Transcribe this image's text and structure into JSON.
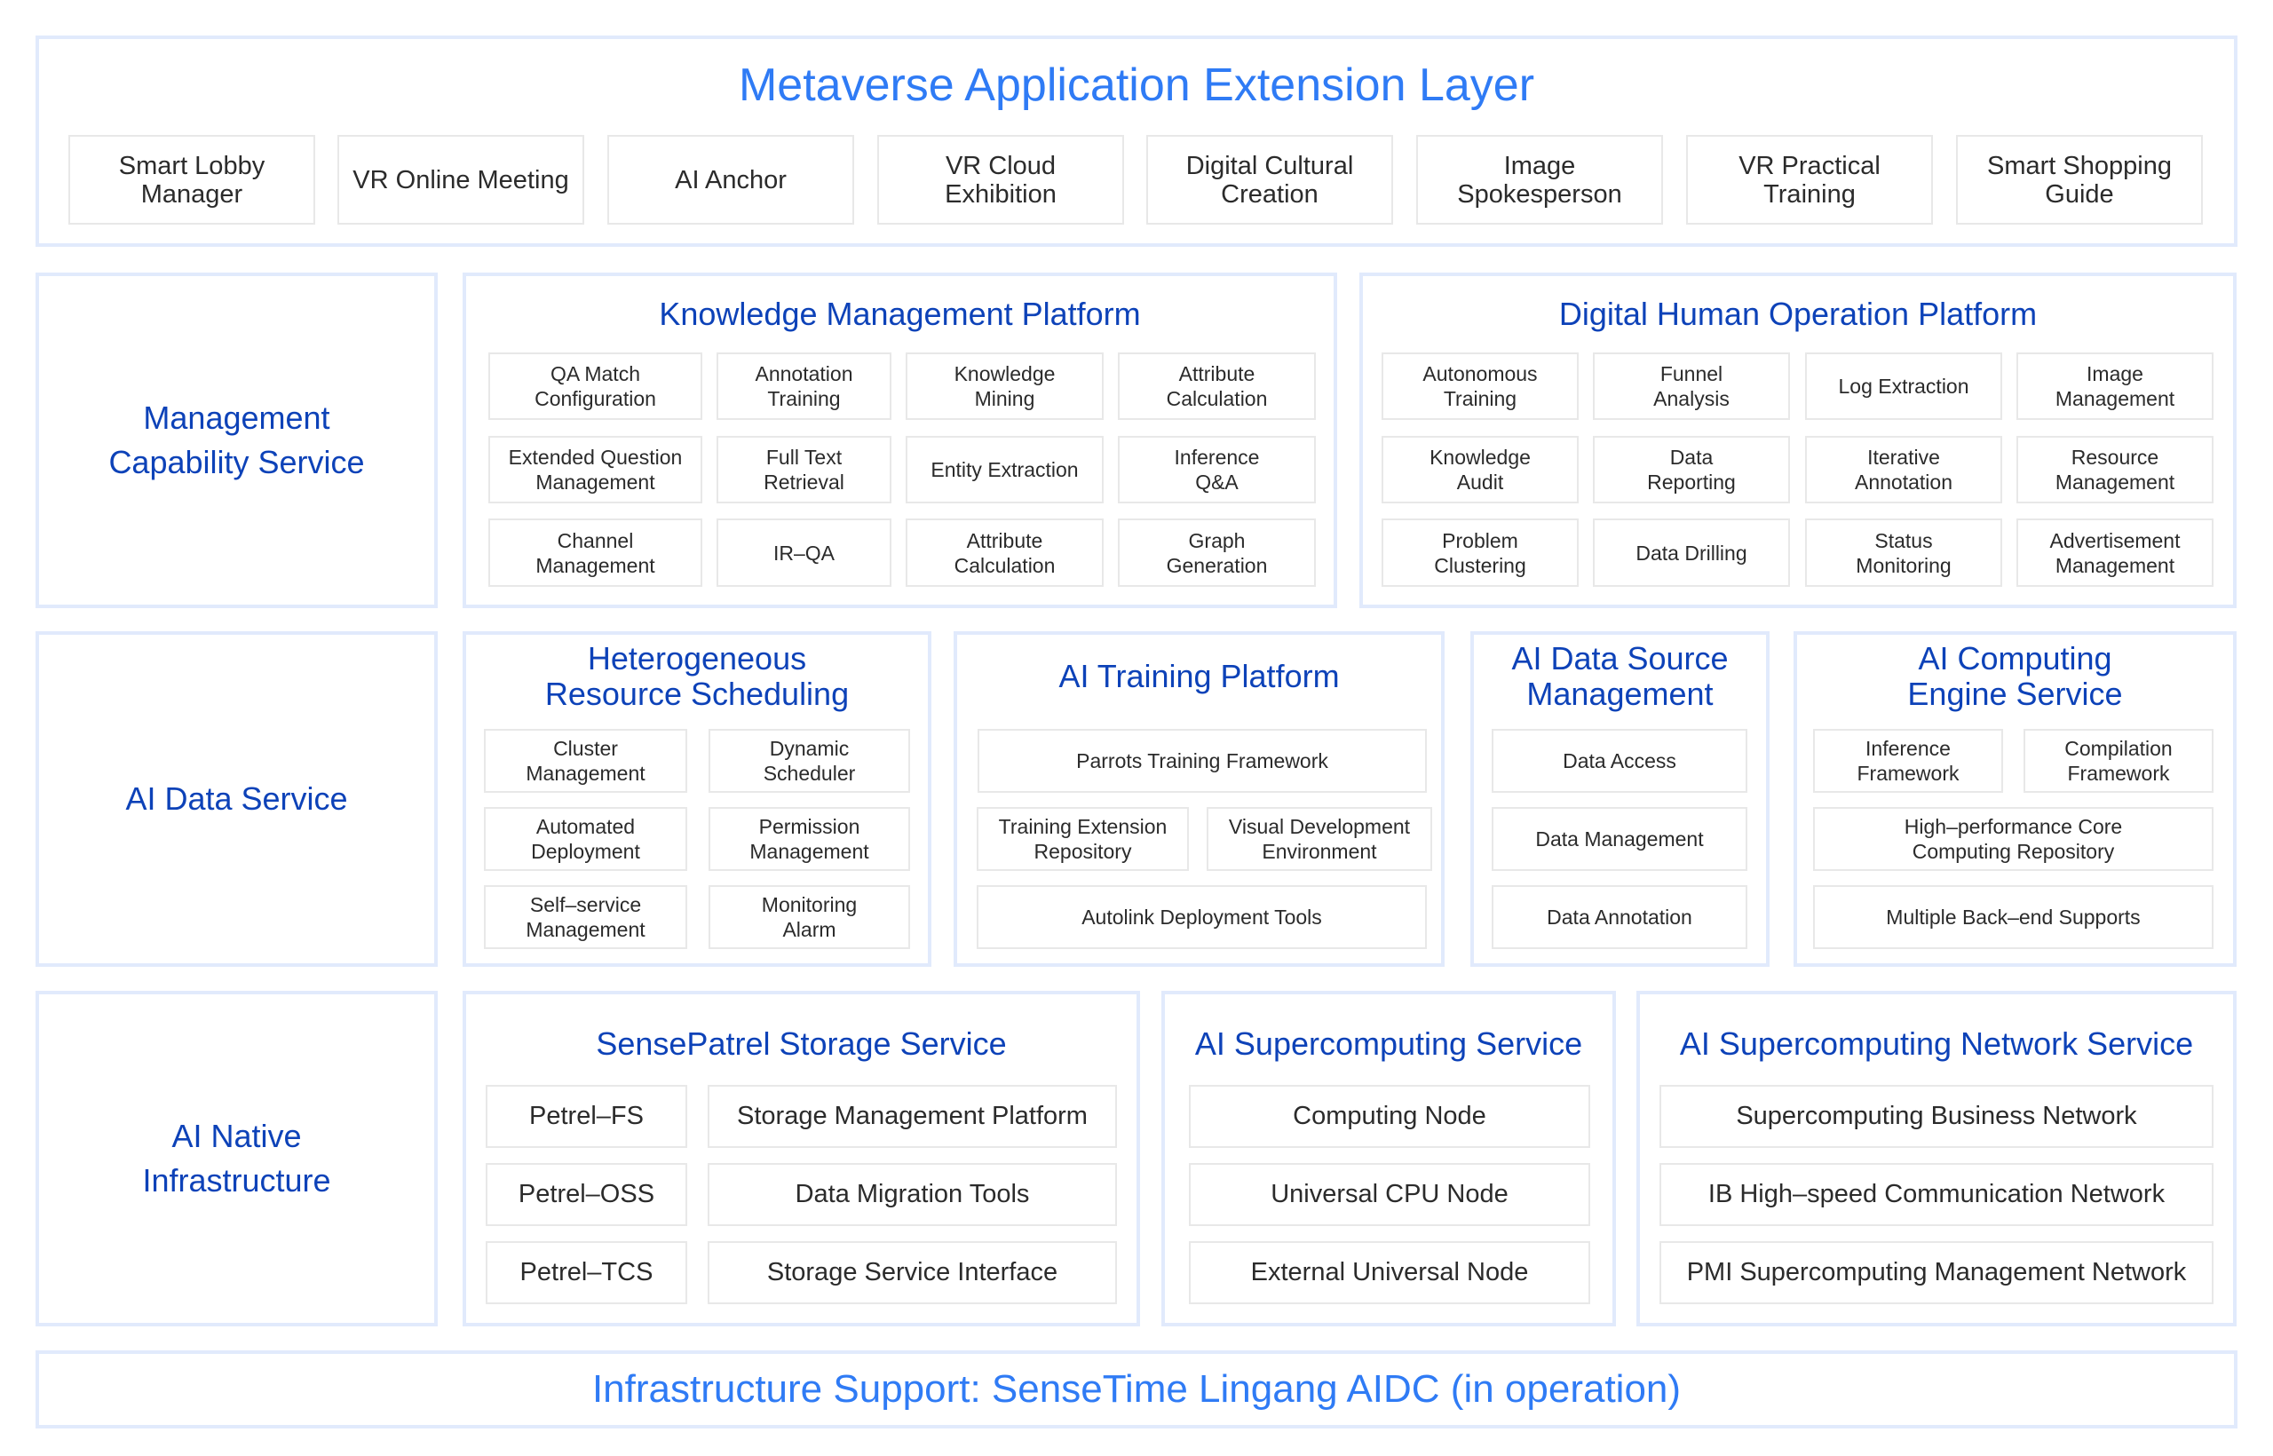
{
  "colors": {
    "main_title": "#2f7bf5",
    "section_title": "#0d42b8",
    "panel_border": "#e1eafc",
    "item_border": "#e8e8e8",
    "item_text": "#2b2b2b"
  },
  "top_layer": {
    "title": "Metaverse Application Extension Layer",
    "items": [
      "Smart Lobby\nManager",
      "VR Online Meeting",
      "AI Anchor",
      "VR Cloud\nExhibition",
      "Digital Cultural\nCreation",
      "Image\nSpokesperson",
      "VR Practical\nTraining",
      "Smart Shopping\nGuide"
    ]
  },
  "rows": {
    "management": {
      "label": "Management\nCapability Service",
      "knowledge_platform": {
        "title": "Knowledge Management Platform",
        "items": [
          "QA Match\nConfiguration",
          "Annotation\nTraining",
          "Knowledge\nMining",
          "Attribute\nCalculation",
          "Extended Question\nManagement",
          "Full Text\nRetrieval",
          "Entity Extraction",
          "Inference\nQ&A",
          "Channel\nManagement",
          "IR–QA",
          "Attribute\nCalculation",
          "Graph\nGeneration"
        ]
      },
      "digital_human_platform": {
        "title": "Digital Human Operation Platform",
        "items": [
          "Autonomous\nTraining",
          "Funnel\nAnalysis",
          "Log Extraction",
          "Image\nManagement",
          "Knowledge\nAudit",
          "Data\nReporting",
          "Iterative\nAnnotation",
          "Resource\nManagement",
          "Problem\nClustering",
          "Data Drilling",
          "Status\nMonitoring",
          "Advertisement\nManagement"
        ]
      }
    },
    "ai_data": {
      "label": "AI Data Service",
      "resource_scheduling": {
        "title": "Heterogeneous\nResource Scheduling",
        "items": [
          "Cluster\nManagement",
          "Dynamic\nScheduler",
          "Automated\nDeployment",
          "Permission\nManagement",
          "Self–service\nManagement",
          "Monitoring\nAlarm"
        ]
      },
      "training_platform": {
        "title": "AI Training Platform",
        "items": [
          "Parrots Training Framework",
          "Training Extension\nRepository",
          "Visual Development\nEnvironment",
          "Autolink Deployment Tools"
        ]
      },
      "data_source": {
        "title": "AI Data Source\nManagement",
        "items": [
          "Data Access",
          "Data Management",
          "Data Annotation"
        ]
      },
      "computing_engine": {
        "title": "AI Computing\nEngine Service",
        "items": [
          "Inference\nFramework",
          "Compilation\nFramework",
          "High–performance Core\nComputing Repository",
          "Multiple Back–end Supports"
        ]
      }
    },
    "infrastructure": {
      "label": "AI Native\nInfrastructure",
      "storage": {
        "title": "SensePatrel Storage Service",
        "items": [
          "Petrel–FS",
          "Storage Management Platform",
          "Petrel–OSS",
          "Data Migration Tools",
          "Petrel–TCS",
          "Storage Service Interface"
        ]
      },
      "supercomputing": {
        "title": "AI Supercomputing Service",
        "items": [
          "Computing Node",
          "Universal CPU Node",
          "External Universal Node"
        ]
      },
      "network": {
        "title": "AI Supercomputing Network Service",
        "items": [
          "Supercomputing Business Network",
          "IB High–speed Communication Network",
          "PMI Supercomputing Management Network"
        ]
      }
    }
  },
  "bottom_bar": {
    "text": "Infrastructure Support: SenseTime Lingang AIDC (in operation)"
  }
}
